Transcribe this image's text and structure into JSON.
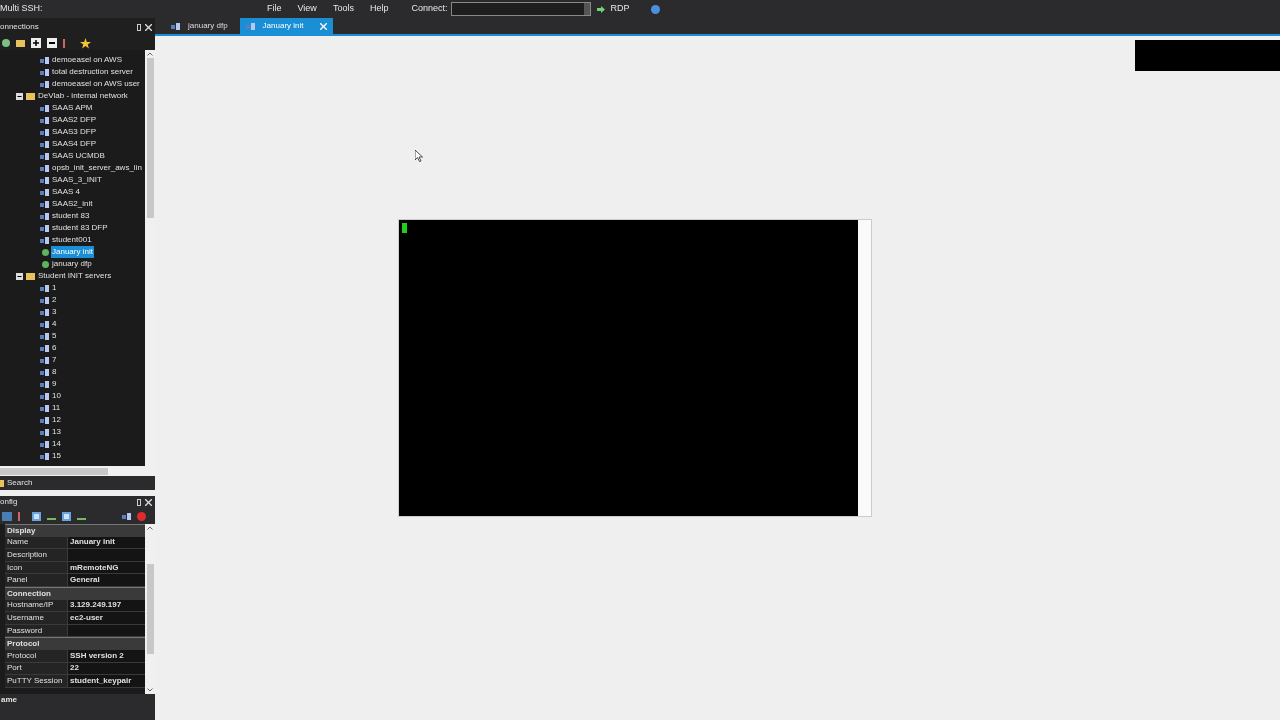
{
  "window": {
    "title": "Multi SSH:"
  },
  "menu": [
    "File",
    "View",
    "Tools",
    "Help"
  ],
  "connect": {
    "label": "Connect:",
    "protocol": "RDP"
  },
  "tabs": [
    {
      "label": "january dfp",
      "selected": false
    },
    {
      "label": "January init",
      "selected": true,
      "closable": true
    }
  ],
  "connections_panel": {
    "title": "onnections",
    "tree": [
      {
        "children": [
          {
            "kind": "connection",
            "label": "demoeasel on AWS",
            "selected": false
          },
          {
            "kind": "connection",
            "label": "total destruction server",
            "selected": false
          },
          {
            "kind": "connection",
            "label": "demoeasel on AWS user",
            "selected": false
          }
        ]
      },
      {
        "kind": "folder",
        "label": "DeVlab - internal network",
        "expanded": true,
        "selected": false,
        "children": [
          {
            "kind": "connection",
            "label": "SAAS APM",
            "selected": false
          },
          {
            "kind": "connection",
            "label": "SAAS2  DFP",
            "selected": false
          },
          {
            "kind": "connection",
            "label": "SAAS3  DFP",
            "selected": false
          },
          {
            "kind": "connection",
            "label": "SAAS4  DFP",
            "selected": false
          },
          {
            "kind": "connection",
            "label": "SAAS UCMDB",
            "selected": false
          },
          {
            "kind": "connection",
            "label": "opsb_init_server_aws_lin",
            "selected": false
          },
          {
            "kind": "connection",
            "label": "SAAS_3_INIT",
            "selected": false
          },
          {
            "kind": "connection",
            "label": "SAAS 4",
            "selected": false
          },
          {
            "kind": "connection",
            "label": "SAAS2_init",
            "selected": false
          },
          {
            "kind": "connection",
            "label": "student 83",
            "selected": false
          },
          {
            "kind": "connection",
            "label": "student 83 DFP",
            "selected": false
          },
          {
            "kind": "connection",
            "label": "student001",
            "selected": false
          },
          {
            "kind": "open",
            "label": "January init",
            "selected": true
          },
          {
            "kind": "open",
            "label": "january dfp",
            "selected": false
          }
        ]
      },
      {
        "kind": "folder",
        "label": "Student INIT servers",
        "expanded": true,
        "selected": false,
        "children": [
          {
            "kind": "connection",
            "label": "1",
            "selected": false
          },
          {
            "kind": "connection",
            "label": "2",
            "selected": false
          },
          {
            "kind": "connection",
            "label": "3",
            "selected": false
          },
          {
            "kind": "connection",
            "label": "4",
            "selected": false
          },
          {
            "kind": "connection",
            "label": "5",
            "selected": false
          },
          {
            "kind": "connection",
            "label": "6",
            "selected": false
          },
          {
            "kind": "connection",
            "label": "7",
            "selected": false
          },
          {
            "kind": "connection",
            "label": "8",
            "selected": false
          },
          {
            "kind": "connection",
            "label": "9",
            "selected": false
          },
          {
            "kind": "connection",
            "label": "10",
            "selected": false
          },
          {
            "kind": "connection",
            "label": "11",
            "selected": false
          },
          {
            "kind": "connection",
            "label": "12",
            "selected": false
          },
          {
            "kind": "connection",
            "label": "13",
            "selected": false
          },
          {
            "kind": "connection",
            "label": "14",
            "selected": false
          },
          {
            "kind": "connection",
            "label": "15",
            "selected": false
          }
        ]
      }
    ],
    "search": "Search"
  },
  "config_panel": {
    "title": "onfig",
    "categories": [
      {
        "name": "Display",
        "rows": [
          {
            "name": "Name",
            "value": "January init"
          },
          {
            "name": "Description"
          },
          {
            "name": "Icon",
            "value": "mRemoteNG"
          },
          {
            "name": "Panel",
            "value": "General"
          }
        ]
      },
      {
        "name": "Connection",
        "rows": [
          {
            "name": "Hostname/IP",
            "value": "3.129.249.197"
          },
          {
            "name": "Username",
            "value": "ec2-user"
          },
          {
            "name": "Password"
          }
        ]
      },
      {
        "name": "Protocol",
        "rows": [
          {
            "name": "Protocol",
            "value": "SSH version 2"
          },
          {
            "name": "Port",
            "value": "22"
          },
          {
            "name": "PuTTY Session",
            "value": "student_keypair"
          }
        ]
      }
    ],
    "description_title": "ame"
  }
}
